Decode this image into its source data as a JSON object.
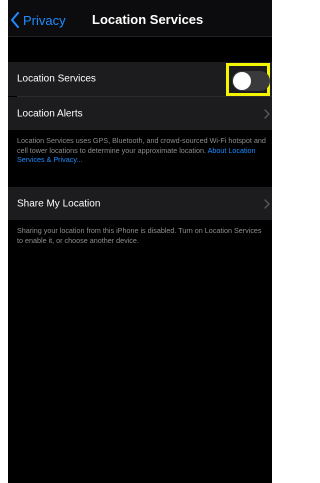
{
  "navbar": {
    "back_label": "Privacy",
    "title": "Location Services"
  },
  "settings": {
    "location_services": {
      "label": "Location Services",
      "enabled": false
    },
    "location_alerts": {
      "label": "Location Alerts"
    },
    "info_text": "Location Services uses GPS, Bluetooth, and crowd-sourced Wi-Fi hotspot and cell tower locations to determine your approximate location.",
    "info_link": "About Location Services & Privacy...",
    "share_location": {
      "label": "Share My Location"
    },
    "share_info": "Sharing your location from this iPhone is disabled. Turn on Location Services to enable it, or choose another device."
  },
  "colors": {
    "background": "#000000",
    "cell": "#1c1c1e",
    "accent_blue": "#1e8cff",
    "highlight": "#f5f500",
    "secondary_text": "#8e8e93"
  },
  "icons": {
    "back": "chevron-left-icon",
    "disclosure": "chevron-right-icon"
  }
}
